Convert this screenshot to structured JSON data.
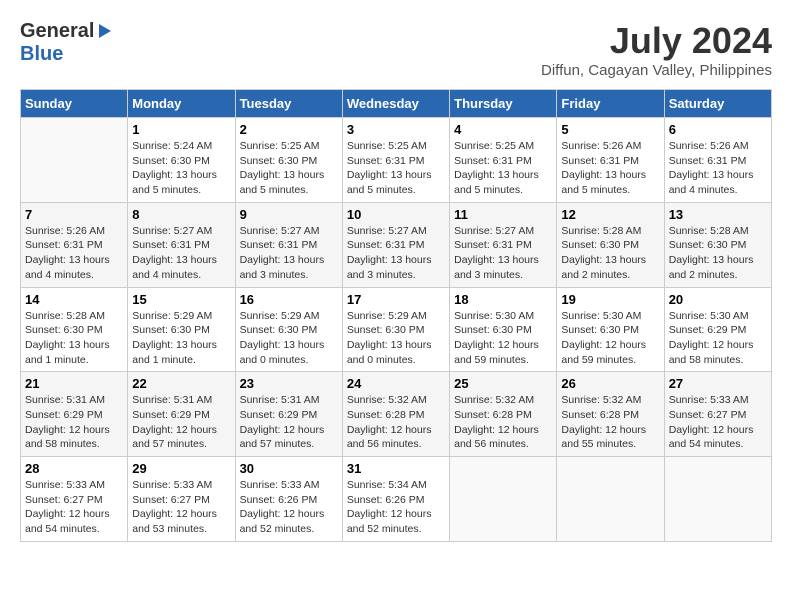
{
  "header": {
    "logo_general": "General",
    "logo_blue": "Blue",
    "month_year": "July 2024",
    "location": "Diffun, Cagayan Valley, Philippines"
  },
  "days_of_week": [
    "Sunday",
    "Monday",
    "Tuesday",
    "Wednesday",
    "Thursday",
    "Friday",
    "Saturday"
  ],
  "weeks": [
    [
      {
        "day": "",
        "info": ""
      },
      {
        "day": "1",
        "info": "Sunrise: 5:24 AM\nSunset: 6:30 PM\nDaylight: 13 hours and 5 minutes."
      },
      {
        "day": "2",
        "info": "Sunrise: 5:25 AM\nSunset: 6:30 PM\nDaylight: 13 hours and 5 minutes."
      },
      {
        "day": "3",
        "info": "Sunrise: 5:25 AM\nSunset: 6:31 PM\nDaylight: 13 hours and 5 minutes."
      },
      {
        "day": "4",
        "info": "Sunrise: 5:25 AM\nSunset: 6:31 PM\nDaylight: 13 hours and 5 minutes."
      },
      {
        "day": "5",
        "info": "Sunrise: 5:26 AM\nSunset: 6:31 PM\nDaylight: 13 hours and 5 minutes."
      },
      {
        "day": "6",
        "info": "Sunrise: 5:26 AM\nSunset: 6:31 PM\nDaylight: 13 hours and 4 minutes."
      }
    ],
    [
      {
        "day": "7",
        "info": "Sunrise: 5:26 AM\nSunset: 6:31 PM\nDaylight: 13 hours and 4 minutes."
      },
      {
        "day": "8",
        "info": "Sunrise: 5:27 AM\nSunset: 6:31 PM\nDaylight: 13 hours and 4 minutes."
      },
      {
        "day": "9",
        "info": "Sunrise: 5:27 AM\nSunset: 6:31 PM\nDaylight: 13 hours and 3 minutes."
      },
      {
        "day": "10",
        "info": "Sunrise: 5:27 AM\nSunset: 6:31 PM\nDaylight: 13 hours and 3 minutes."
      },
      {
        "day": "11",
        "info": "Sunrise: 5:27 AM\nSunset: 6:31 PM\nDaylight: 13 hours and 3 minutes."
      },
      {
        "day": "12",
        "info": "Sunrise: 5:28 AM\nSunset: 6:30 PM\nDaylight: 13 hours and 2 minutes."
      },
      {
        "day": "13",
        "info": "Sunrise: 5:28 AM\nSunset: 6:30 PM\nDaylight: 13 hours and 2 minutes."
      }
    ],
    [
      {
        "day": "14",
        "info": "Sunrise: 5:28 AM\nSunset: 6:30 PM\nDaylight: 13 hours and 1 minute."
      },
      {
        "day": "15",
        "info": "Sunrise: 5:29 AM\nSunset: 6:30 PM\nDaylight: 13 hours and 1 minute."
      },
      {
        "day": "16",
        "info": "Sunrise: 5:29 AM\nSunset: 6:30 PM\nDaylight: 13 hours and 0 minutes."
      },
      {
        "day": "17",
        "info": "Sunrise: 5:29 AM\nSunset: 6:30 PM\nDaylight: 13 hours and 0 minutes."
      },
      {
        "day": "18",
        "info": "Sunrise: 5:30 AM\nSunset: 6:30 PM\nDaylight: 12 hours and 59 minutes."
      },
      {
        "day": "19",
        "info": "Sunrise: 5:30 AM\nSunset: 6:30 PM\nDaylight: 12 hours and 59 minutes."
      },
      {
        "day": "20",
        "info": "Sunrise: 5:30 AM\nSunset: 6:29 PM\nDaylight: 12 hours and 58 minutes."
      }
    ],
    [
      {
        "day": "21",
        "info": "Sunrise: 5:31 AM\nSunset: 6:29 PM\nDaylight: 12 hours and 58 minutes."
      },
      {
        "day": "22",
        "info": "Sunrise: 5:31 AM\nSunset: 6:29 PM\nDaylight: 12 hours and 57 minutes."
      },
      {
        "day": "23",
        "info": "Sunrise: 5:31 AM\nSunset: 6:29 PM\nDaylight: 12 hours and 57 minutes."
      },
      {
        "day": "24",
        "info": "Sunrise: 5:32 AM\nSunset: 6:28 PM\nDaylight: 12 hours and 56 minutes."
      },
      {
        "day": "25",
        "info": "Sunrise: 5:32 AM\nSunset: 6:28 PM\nDaylight: 12 hours and 56 minutes."
      },
      {
        "day": "26",
        "info": "Sunrise: 5:32 AM\nSunset: 6:28 PM\nDaylight: 12 hours and 55 minutes."
      },
      {
        "day": "27",
        "info": "Sunrise: 5:33 AM\nSunset: 6:27 PM\nDaylight: 12 hours and 54 minutes."
      }
    ],
    [
      {
        "day": "28",
        "info": "Sunrise: 5:33 AM\nSunset: 6:27 PM\nDaylight: 12 hours and 54 minutes."
      },
      {
        "day": "29",
        "info": "Sunrise: 5:33 AM\nSunset: 6:27 PM\nDaylight: 12 hours and 53 minutes."
      },
      {
        "day": "30",
        "info": "Sunrise: 5:33 AM\nSunset: 6:26 PM\nDaylight: 12 hours and 52 minutes."
      },
      {
        "day": "31",
        "info": "Sunrise: 5:34 AM\nSunset: 6:26 PM\nDaylight: 12 hours and 52 minutes."
      },
      {
        "day": "",
        "info": ""
      },
      {
        "day": "",
        "info": ""
      },
      {
        "day": "",
        "info": ""
      }
    ]
  ]
}
